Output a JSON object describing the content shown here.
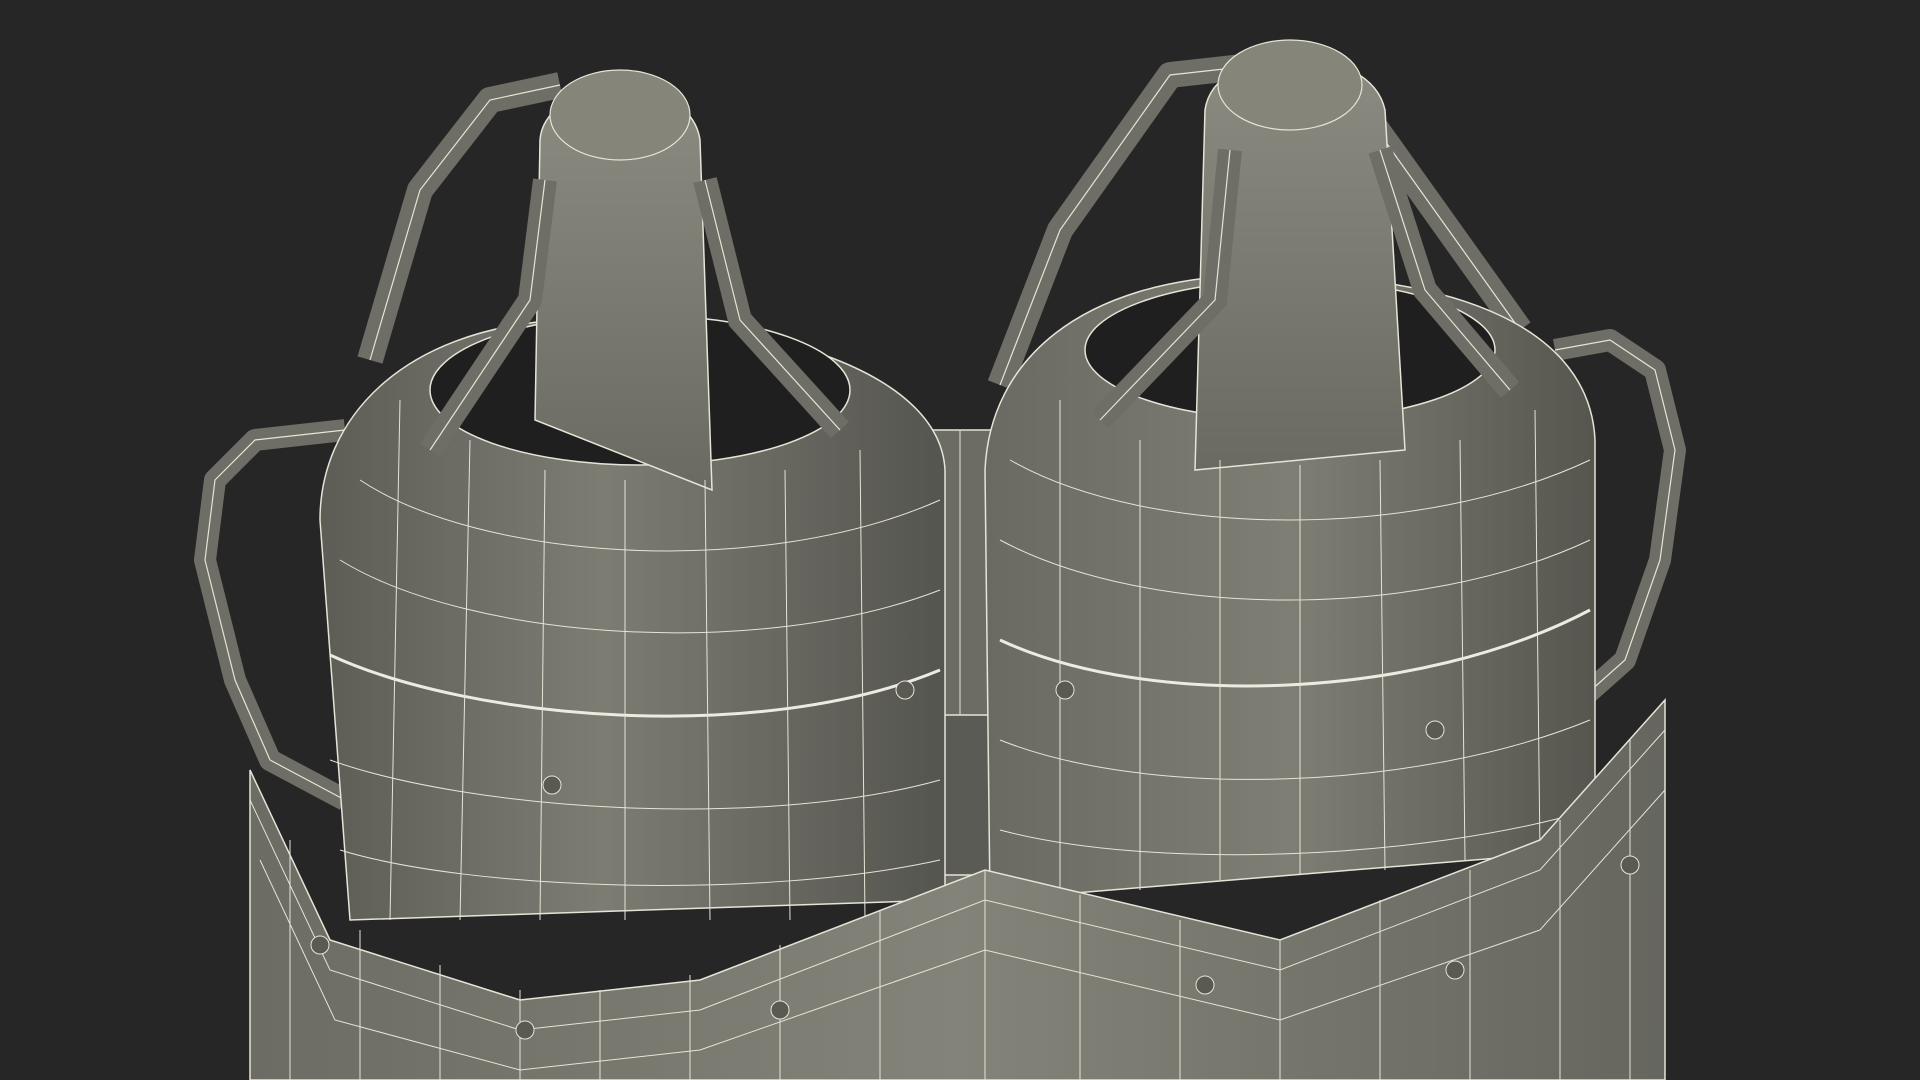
{
  "scene": {
    "subject": "wireframe-render",
    "background_color": "#262626",
    "shell_color": "#6e6e66",
    "shell_dark_color": "#4a4a44",
    "shell_light_color": "#8a8a80",
    "wire_color": "#e6e4d6",
    "interior_color": "#1f1f1f",
    "icons": [
      "engine-left-icon",
      "engine-right-icon"
    ]
  }
}
